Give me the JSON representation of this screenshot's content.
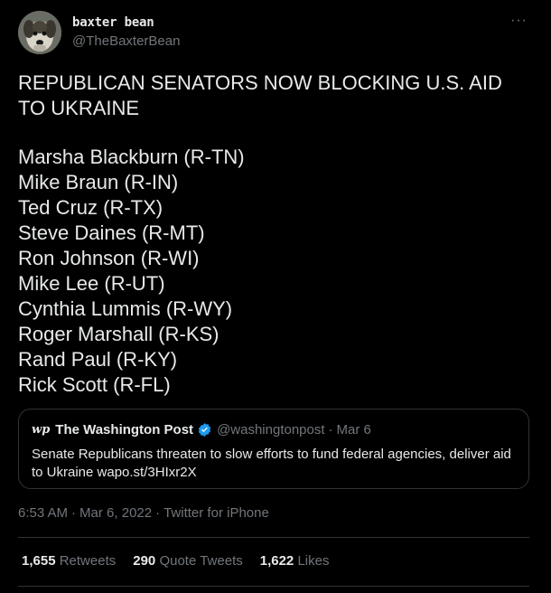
{
  "author": {
    "display_name": "baxter bean",
    "handle": "@TheBaxterBean"
  },
  "menu": {
    "more_icon": "more-horizontal-icon",
    "more_glyph": "···"
  },
  "tweet": {
    "headline": "REPUBLICAN SENATORS NOW BLOCKING U.S. AID TO UKRAINE",
    "senators": [
      "Marsha Blackburn (R-TN)",
      "Mike Braun (R-IN)",
      "Ted Cruz (R-TX)",
      "Steve Daines (R-MT)",
      "Ron Johnson (R-WI)",
      "Mike Lee (R-UT)",
      "Cynthia Lummis (R-WY)",
      "Roger Marshall (R-KS)",
      "Rand Paul (R-KY)",
      "Rick Scott (R-FL)"
    ]
  },
  "quote": {
    "logo": "wp",
    "name": "The Washington Post",
    "verified_icon": "verified-badge-icon",
    "handle": "@washingtonpost",
    "separator": "·",
    "date": "Mar 6",
    "text": "Senate Republicans threaten to slow efforts to fund federal agencies, deliver aid to Ukraine wapo.st/3HIxr2X"
  },
  "meta": {
    "time": "6:53 AM",
    "separator": "·",
    "date": "Mar 6, 2022",
    "source": "Twitter for iPhone"
  },
  "stats": {
    "retweets": {
      "count": "1,655",
      "label": "Retweets"
    },
    "quote_tweets": {
      "count": "290",
      "label": "Quote Tweets"
    },
    "likes": {
      "count": "1,622",
      "label": "Likes"
    }
  },
  "colors": {
    "background": "#000000",
    "text": "#e7e9ea",
    "secondary": "#71767b",
    "border": "#2f3336",
    "verified": "#1d9bf0"
  }
}
